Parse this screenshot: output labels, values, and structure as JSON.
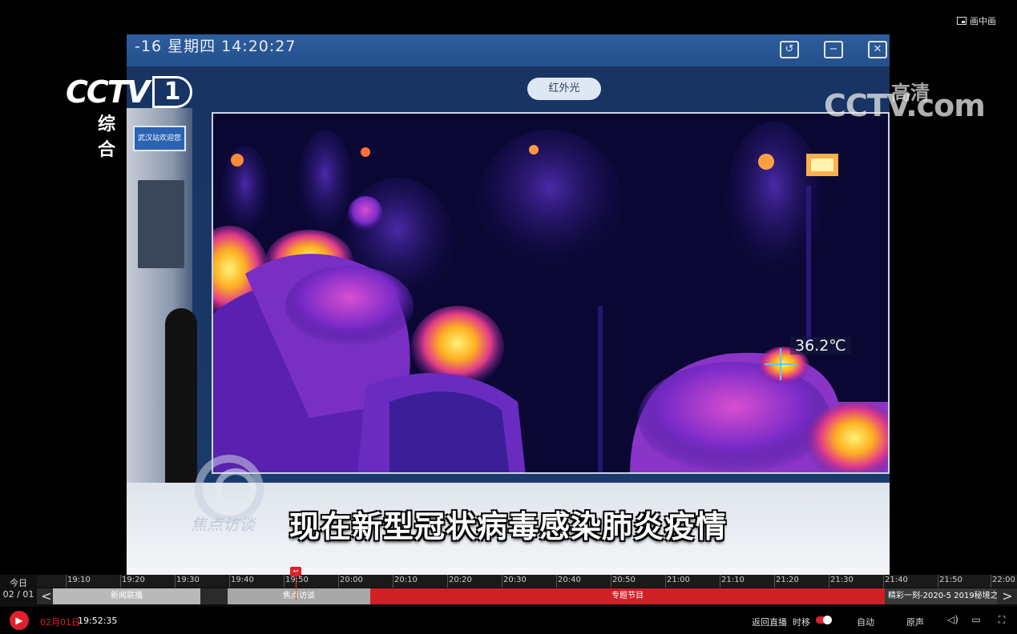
{
  "overlay": {
    "pip_label": "画中画"
  },
  "video": {
    "monitor_clock": "-16  星期四  14:20:27",
    "monitor_buttons": {
      "refresh": "↺",
      "minimize": "−",
      "close": "✕"
    },
    "ir_label": "红外光",
    "station_sign": "武汉站欢迎您",
    "temperature": "36.2℃",
    "subtitle": "现在新型冠状病毒感染肺炎疫情",
    "show_logo_text": "焦点访谈"
  },
  "channel": {
    "logo_word": "CCTV",
    "logo_number": "1",
    "logo_sub": "综合",
    "site_logo": "CCTV.com",
    "hd_badge": "高清"
  },
  "timeline": {
    "date_top": "今日",
    "date_bottom": "02 / 01",
    "ticks": [
      "19:10",
      "19:20",
      "19:30",
      "19:40",
      "19:50",
      "20:00",
      "20:10",
      "20:20",
      "20:30",
      "20:40",
      "20:50",
      "21:00",
      "21:10",
      "21:20",
      "21:30",
      "21:40",
      "21:50",
      "22:00"
    ],
    "segments": [
      {
        "label": "新闻联播",
        "color": "#b9b9b9"
      },
      {
        "label": "焦点访谈",
        "color": "#a8a8a8"
      },
      {
        "label": "专题节目",
        "color": "#d11f26"
      },
      {
        "label": "精彩一刻-2020-5 2019秘境之",
        "color": "#3a3a3a"
      }
    ],
    "prev": "<",
    "next": ">",
    "playhead_icon": "↩"
  },
  "controls": {
    "current_date": "02月01日",
    "current_time": "19:52:35",
    "back_live": "返回直播",
    "timeshift": "时移",
    "quality": "自动",
    "audio": "原声"
  },
  "colors": {
    "accent": "#e0202a",
    "background": "#000000"
  }
}
